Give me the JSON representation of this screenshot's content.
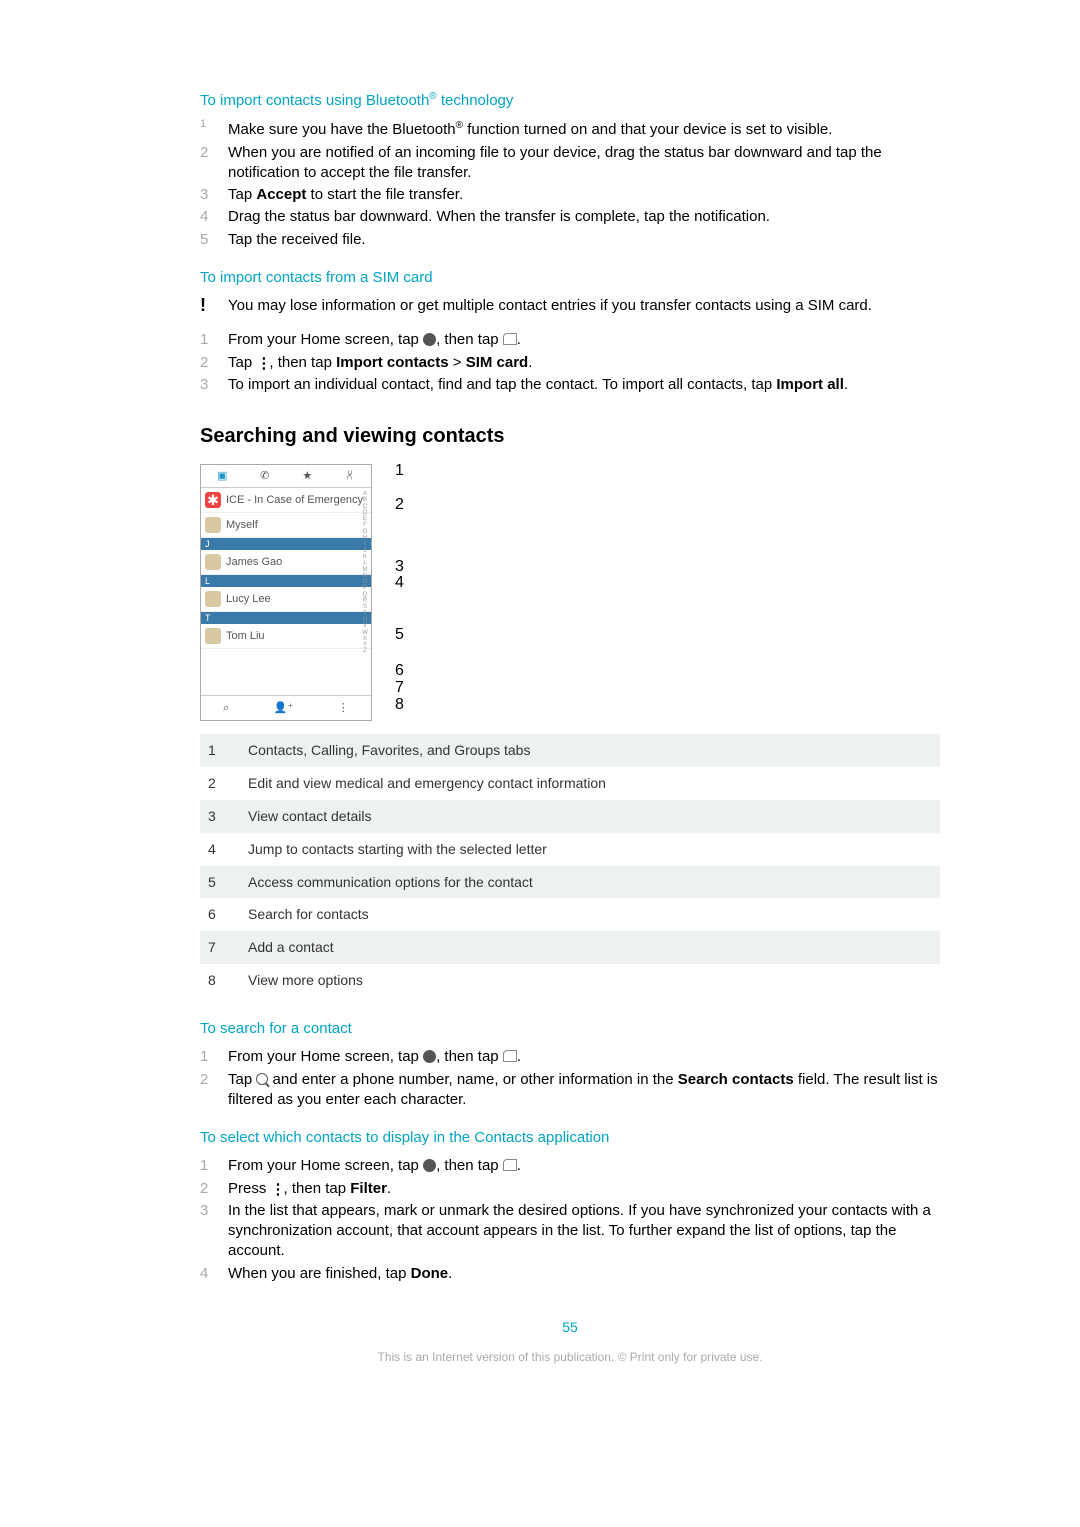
{
  "sections": {
    "bt": {
      "title_pre": "To import contacts using Bluetooth",
      "title_post": " technology",
      "reg": "®",
      "steps": [
        {
          "n": "1",
          "sup": true,
          "html": "Make sure you have the Bluetooth<sup class='sup'>®</sup> function turned on and that your device is set to visible."
        },
        {
          "n": "2",
          "html": "When you are notified of an incoming file to your device, drag the status bar downward and tap the notification to accept the file transfer."
        },
        {
          "n": "3",
          "html": "Tap <b>Accept</b> to start the file transfer."
        },
        {
          "n": "4",
          "html": "Drag the status bar downward. When the transfer is complete, tap the notification."
        },
        {
          "n": "5",
          "html": "Tap the received file."
        }
      ]
    },
    "sim": {
      "title": "To import contacts from a SIM card",
      "warn": "You may lose information or get multiple contact entries if you transfer contacts using a SIM card.",
      "steps": [
        {
          "n": "1",
          "html": "From your Home screen, tap <span class='inline-icon' data-name='apps-icon' data-interactable='false'></span>, then tap <span class='icon-card' data-name='contacts-icon' data-interactable='false'></span>."
        },
        {
          "n": "2",
          "html": "Tap <span class='icon-dots' data-name='more-icon' data-interactable='false'>⋮</span>, then tap <b>Import contacts</b> &gt; <b>SIM card</b>."
        },
        {
          "n": "3",
          "html": "To import an individual contact, find and tap the contact. To import all contacts, tap <b>Import all</b>."
        }
      ]
    },
    "search_view": {
      "heading": "Searching and viewing contacts",
      "figure": {
        "tabs": [
          "▣",
          "✆",
          "★",
          "⩆"
        ],
        "ice": "ICE - In Case of Emergency",
        "myself": "Myself",
        "sepJ": "J",
        "james": "James Gao",
        "sepL": "L",
        "lucy": "Lucy Lee",
        "sepT": "T",
        "tom": "Tom Liu",
        "idx": "A B C D E F G H I J K L M N O P Q R S T U V W X Y Z",
        "bottom": [
          "⌕",
          "👤⁺",
          "⋮"
        ]
      },
      "table": [
        {
          "n": "1",
          "desc": "Contacts, Calling, Favorites, and Groups tabs"
        },
        {
          "n": "2",
          "desc": "Edit and view medical and emergency contact information"
        },
        {
          "n": "3",
          "desc": "View contact details"
        },
        {
          "n": "4",
          "desc": "Jump to contacts starting with the selected letter"
        },
        {
          "n": "5",
          "desc": "Access communication options for the contact"
        },
        {
          "n": "6",
          "desc": "Search for contacts"
        },
        {
          "n": "7",
          "desc": "Add a contact"
        },
        {
          "n": "8",
          "desc": "View more options"
        }
      ]
    },
    "search": {
      "title": "To search for a contact",
      "steps": [
        {
          "n": "1",
          "html": "From your Home screen, tap <span class='inline-icon' data-name='apps-icon' data-interactable='false'></span>, then tap <span class='icon-card' data-name='contacts-icon' data-interactable='false'></span>."
        },
        {
          "n": "2",
          "html": "Tap <span class='icon-search' data-name='search-icon' data-interactable='false'></span> and enter a phone number, name, or other information in the <b>Search contacts</b> field. The result list is filtered as you enter each character."
        }
      ]
    },
    "select": {
      "title": "To select which contacts to display in the Contacts application",
      "steps": [
        {
          "n": "1",
          "html": "From your Home screen, tap <span class='inline-icon' data-name='apps-icon' data-interactable='false'></span>, then tap <span class='icon-card' data-name='contacts-icon' data-interactable='false'></span>."
        },
        {
          "n": "2",
          "html": "Press <span class='icon-dots' data-name='more-icon' data-interactable='false'>⋮</span>, then tap <b>Filter</b>."
        },
        {
          "n": "3",
          "html": "In the list that appears, mark or unmark the desired options. If you have synchronized your contacts with a synchronization account, that account appears in the list. To further expand the list of options, tap the account."
        },
        {
          "n": "4",
          "html": "When you are finished, tap <b>Done</b>."
        }
      ]
    }
  },
  "pageNumber": "55",
  "footer": "This is an Internet version of this publication. © Print only for private use."
}
